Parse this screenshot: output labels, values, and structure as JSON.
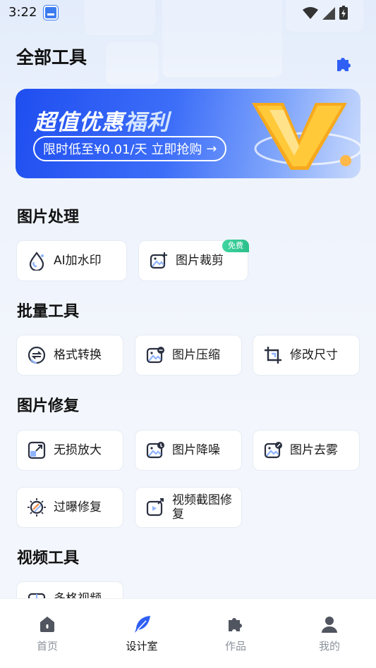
{
  "status_bar": {
    "time": "3:22"
  },
  "header": {
    "title": "全部工具"
  },
  "banner": {
    "title_main": "超值优惠",
    "title_accent": "福利",
    "pill_text": "限时低至¥0.01/天  立即抢购",
    "arrow": "→"
  },
  "sections": [
    {
      "title": "图片处理",
      "items": [
        {
          "label": "AI加水印",
          "icon": "water-drop-icon"
        },
        {
          "label": "图片裁剪",
          "icon": "image-crop-icon",
          "badge": "免费"
        }
      ]
    },
    {
      "title": "批量工具",
      "items": [
        {
          "label": "格式转换",
          "icon": "convert-icon"
        },
        {
          "label": "图片压缩",
          "icon": "image-compress-icon"
        },
        {
          "label": "修改尺寸",
          "icon": "crop-icon"
        }
      ]
    },
    {
      "title": "图片修复",
      "items": [
        {
          "label": "无损放大",
          "icon": "enlarge-icon"
        },
        {
          "label": "图片降噪",
          "icon": "image-denoise-icon"
        },
        {
          "label": "图片去雾",
          "icon": "image-dehaze-icon"
        },
        {
          "label": "过曝修复",
          "icon": "exposure-icon"
        },
        {
          "label": "视频截图修复",
          "icon": "video-screenshot-icon"
        }
      ]
    },
    {
      "title": "视频工具",
      "items": [
        {
          "label": "多格视频",
          "icon": "video-grid-icon"
        }
      ]
    }
  ],
  "tabbar": [
    {
      "label": "首页",
      "icon": "home-icon"
    },
    {
      "label": "设计室",
      "icon": "feather-icon",
      "active": true
    },
    {
      "label": "作品",
      "icon": "puzzle-icon"
    },
    {
      "label": "我的",
      "icon": "user-icon"
    }
  ],
  "colors": {
    "accent": "#2f5ff5",
    "icon_dark": "#2a3040",
    "icon_light": "#8fb4ff"
  }
}
